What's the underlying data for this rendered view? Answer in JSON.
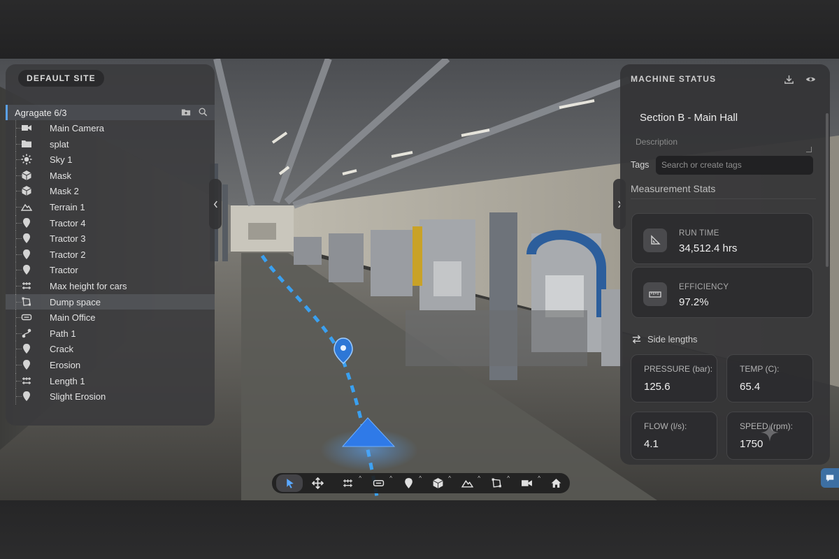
{
  "left_panel": {
    "site_label": "DEFAULT SITE",
    "tree_header": "Agragate 6/3",
    "items": [
      {
        "label": "Main Camera",
        "icon": "video-camera-icon"
      },
      {
        "label": "splat",
        "icon": "folder-icon"
      },
      {
        "label": "Sky 1",
        "icon": "sun-icon"
      },
      {
        "label": "Mask",
        "icon": "cube-icon"
      },
      {
        "label": "Mask 2",
        "icon": "cube-icon"
      },
      {
        "label": "Terrain 1",
        "icon": "mountain-icon"
      },
      {
        "label": "Tractor 4",
        "icon": "map-pin-icon"
      },
      {
        "label": "Tractor 3",
        "icon": "map-pin-icon"
      },
      {
        "label": "Tractor 2",
        "icon": "map-pin-icon"
      },
      {
        "label": "Tractor",
        "icon": "map-pin-icon"
      },
      {
        "label": "Max height for cars",
        "icon": "measure-icon"
      },
      {
        "label": "Dump space",
        "icon": "area-icon",
        "selected": true
      },
      {
        "label": "Main Office",
        "icon": "label-icon"
      },
      {
        "label": "Path 1",
        "icon": "path-icon"
      },
      {
        "label": "Crack",
        "icon": "map-pin-icon"
      },
      {
        "label": "Erosion",
        "icon": "map-pin-icon"
      },
      {
        "label": "Length 1",
        "icon": "measure-icon"
      },
      {
        "label": "Slight Erosion",
        "icon": "map-pin-icon"
      }
    ]
  },
  "right_panel": {
    "title": "MACHINE STATUS",
    "section_name": "Section B - Main Hall",
    "description_placeholder": "Description",
    "tags_label": "Tags",
    "tags_placeholder": "Search or create tags",
    "measurement_title": "Measurement Stats",
    "stats": [
      {
        "label": "RUN TIME",
        "value": "34,512.4 hrs",
        "icon": "set-square-icon"
      },
      {
        "label": "EFFICIENCY",
        "value": "97.2%",
        "icon": "ruler-icon"
      }
    ],
    "side_lengths_label": "Side lengths",
    "metrics": [
      {
        "label": "PRESSURE (bar):",
        "value": "125.6"
      },
      {
        "label": "TEMP (C):",
        "value": "65.4"
      },
      {
        "label": "FLOW (l/s):",
        "value": "4.1"
      },
      {
        "label": "SPEED (rpm):",
        "value": "1750"
      }
    ]
  },
  "toolbar": {
    "tools": [
      {
        "name": "select-tool",
        "icon": "cursor-icon",
        "active": true,
        "caret": false
      },
      {
        "name": "move-tool",
        "icon": "move-icon",
        "active": false,
        "caret": false
      },
      {
        "name": "measure-tool",
        "icon": "measure-icon",
        "active": false,
        "caret": true
      },
      {
        "name": "label-tool",
        "icon": "label-icon",
        "active": false,
        "caret": true
      },
      {
        "name": "pin-tool",
        "icon": "map-pin-icon",
        "active": false,
        "caret": true
      },
      {
        "name": "cube-tool",
        "icon": "cube-icon",
        "active": false,
        "caret": true
      },
      {
        "name": "terrain-tool",
        "icon": "mountain-icon",
        "active": false,
        "caret": true
      },
      {
        "name": "area-tool",
        "icon": "area-icon",
        "active": false,
        "caret": true
      },
      {
        "name": "camera-tool",
        "icon": "video-camera-icon",
        "active": false,
        "caret": true
      },
      {
        "name": "home-tool",
        "icon": "home-icon",
        "active": false,
        "caret": false
      }
    ]
  },
  "colors": {
    "accent": "#3d86e6",
    "panel": "#3a3a3c",
    "path_dash": "#3aa0f0"
  }
}
